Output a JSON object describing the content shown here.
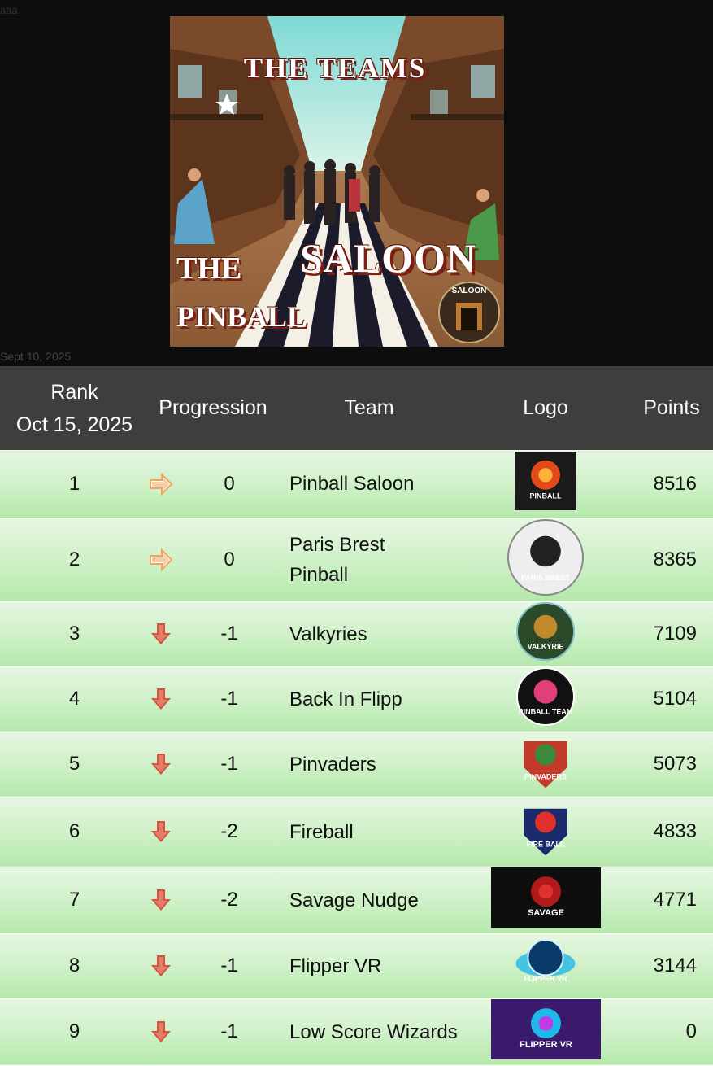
{
  "hero": {
    "corner_label": "aaa",
    "date_label": "Sept 10, 2025",
    "poster": {
      "title": "THE TEAMS",
      "word_the": "THE",
      "word_pinball": "PINBALL",
      "word_saloon": "SALOON",
      "badge": "SALOON"
    }
  },
  "table": {
    "headers": {
      "rank": "Rank",
      "rank_date": "Oct 15, 2025",
      "progression": "Progression",
      "team": "Team",
      "logo": "Logo",
      "points": "Points"
    },
    "rows": [
      {
        "rank": "1",
        "trend": "same",
        "change": "0",
        "team": "Pinball Saloon",
        "logo_text": "PINBALL",
        "logo_icon": "pinball-saloon-logo",
        "points": "8516"
      },
      {
        "rank": "2",
        "trend": "same",
        "change": "0",
        "team": "Paris Brest Pinball",
        "logo_text": "PARIS BREST",
        "logo_icon": "paris-brest-logo",
        "points": "8365"
      },
      {
        "rank": "3",
        "trend": "down",
        "change": "-1",
        "team": "Valkyries",
        "logo_text": "VALKYRIE",
        "logo_icon": "valkyries-logo",
        "points": "7109"
      },
      {
        "rank": "4",
        "trend": "down",
        "change": "-1",
        "team": "Back In Flipp",
        "logo_text": "PINBALL TEAM",
        "logo_icon": "back-in-flipp-logo",
        "points": "5104"
      },
      {
        "rank": "5",
        "trend": "down",
        "change": "-1",
        "team": "Pinvaders",
        "logo_text": "PINVADERS",
        "logo_icon": "pinvaders-logo",
        "points": "5073"
      },
      {
        "rank": "6",
        "trend": "down",
        "change": "-2",
        "team": "Fireball",
        "logo_text": "FIRE BALL",
        "logo_icon": "fireball-logo",
        "points": "4833"
      },
      {
        "rank": "7",
        "trend": "down",
        "change": "-2",
        "team": "Savage Nudge",
        "logo_text": "SAVAGE",
        "logo_icon": "savage-nudge-logo",
        "points": "4771"
      },
      {
        "rank": "8",
        "trend": "down",
        "change": "-1",
        "team": "Flipper VR",
        "logo_text": "FLIPPER VR",
        "logo_icon": "flipper-vr-logo",
        "points": "3144"
      },
      {
        "rank": "9",
        "trend": "down",
        "change": "-1",
        "team": "Low Score Wizards",
        "logo_text": "FLIPPER VR",
        "logo_icon": "low-score-wizards-logo",
        "points": "0"
      }
    ]
  },
  "colors": {
    "header_bg": "#3e3e3e",
    "row_green_light": "#e6f7e2",
    "row_green_dark": "#b5e8ab",
    "arrow_same": "#f0a55a",
    "arrow_down": "#d9523b"
  }
}
